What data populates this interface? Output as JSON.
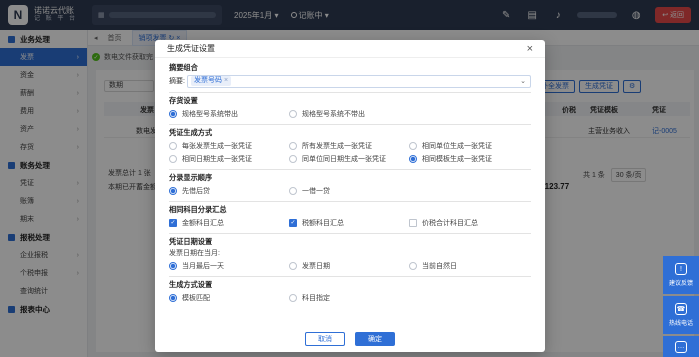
{
  "app": {
    "logo_line1": "诺诺云代账",
    "logo_line2": "记 账 平 台",
    "period": "2025年1月",
    "status": "记账中",
    "back_label": "返回"
  },
  "sidebar": {
    "sections": [
      {
        "title": "业务处理",
        "items": [
          "发票",
          "资金",
          "薪酬",
          "费用",
          "资产",
          "存货"
        ]
      },
      {
        "title": "账务处理",
        "items": [
          "凭证",
          "账簿",
          "期末"
        ]
      },
      {
        "title": "报税处理",
        "items": [
          "企业报税",
          "个税申报",
          "查询统计"
        ]
      },
      {
        "title": "报表中心",
        "items": []
      }
    ]
  },
  "tabs": {
    "home": "首页",
    "current": "销项发票"
  },
  "notice": "数电文件获取完",
  "background": {
    "filter": "数期",
    "buttons": [
      "补全发票",
      "生成凭证",
      "⚙"
    ],
    "table_headers": [
      "发票",
      "价税",
      "凭证模板",
      "凭证"
    ],
    "row": [
      "数电发",
      "主营业务收入",
      "记-0005"
    ],
    "total_label": "发票总计 1 张",
    "opening_label": "本期已开蓄金额",
    "amount": "3,123.77",
    "pager": [
      "共 1 条",
      "30 条/页"
    ]
  },
  "float": {
    "feedback": "建议反馈",
    "hotline": "热线电话"
  },
  "modal": {
    "title": "生成凭证设置",
    "summary": {
      "title": "摘要组合",
      "label": "摘要:",
      "tag": "发票号码"
    },
    "storage": {
      "title": "存货设置",
      "options": [
        "规格型号系统带出",
        "规格型号系统不带出"
      ]
    },
    "method": {
      "title": "凭证生成方式",
      "options": [
        "每张发票生成一张凭证",
        "所有发票生成一张凭证",
        "相同单位生成一张凭证",
        "相同日期生成一张凭证",
        "同单位同日期生成一张凭证",
        "相同模板生成一张凭证"
      ]
    },
    "order": {
      "title": "分录显示顺序",
      "options": [
        "先借后贷",
        "一借一贷"
      ]
    },
    "merge": {
      "title": "相同科目分录汇总",
      "options": [
        "金额科目汇总",
        "税额科目汇总",
        "价税合计科目汇总"
      ]
    },
    "date": {
      "title": "凭证日期设置",
      "sublabel": "发票日期在当月:",
      "options": [
        "当月最后一天",
        "发票日期",
        "当前自然日"
      ]
    },
    "gen": {
      "title": "生成方式设置",
      "options": [
        "模板匹配",
        "科目指定"
      ]
    },
    "cancel": "取消",
    "confirm": "确定"
  }
}
